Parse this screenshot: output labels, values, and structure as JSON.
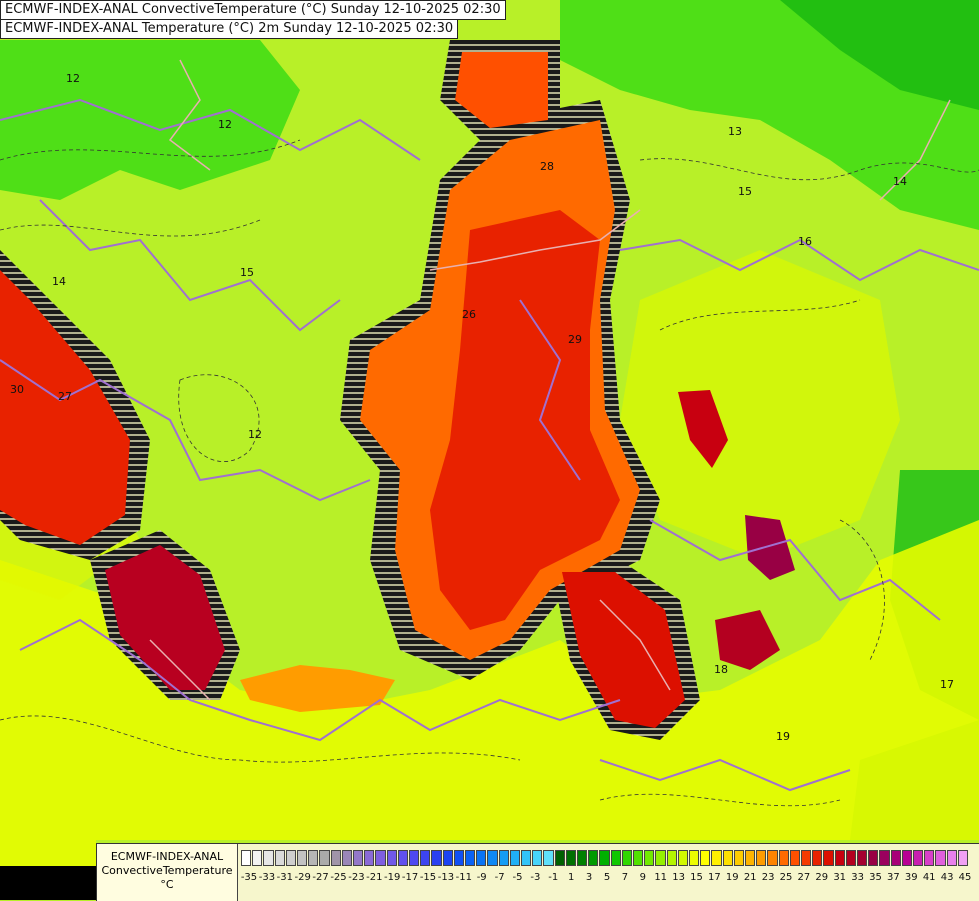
{
  "titles": {
    "line1": "ECMWF-INDEX-ANAL ConvectiveTemperature (°C) Sunday 12-10-2025 02:30",
    "line2": "ECMWF-INDEX-ANAL Temperature (°C) 2m Sunday 12-10-2025 02:30"
  },
  "legend": {
    "model": "ECMWF-INDEX-ANAL",
    "parameter": "ConvectiveTemperature",
    "unit": "°C",
    "tick_labels": [
      "-35",
      "-33",
      "-31",
      "-29",
      "-27",
      "-25",
      "-23",
      "-21",
      "-19",
      "-17",
      "-15",
      "-13",
      "-11",
      "-9",
      "-7",
      "-5",
      "-3",
      "-1",
      "1",
      "3",
      "5",
      "7",
      "9",
      "11",
      "13",
      "15",
      "17",
      "19",
      "21",
      "23",
      "25",
      "27",
      "29",
      "31",
      "33",
      "35",
      "37",
      "39",
      "41",
      "43",
      "45"
    ],
    "colors": [
      "#ffffff",
      "#f2f2f2",
      "#e6e6e6",
      "#dadada",
      "#cecece",
      "#c2c2c2",
      "#b6b6b6",
      "#aaaaaa",
      "#a094a8",
      "#9a86b8",
      "#9478c8",
      "#8a6ad6",
      "#7e5ee0",
      "#7058e8",
      "#6050ee",
      "#4e48f0",
      "#3c44f0",
      "#2a40f0",
      "#1c44f2",
      "#1050f4",
      "#0a62f4",
      "#0a74f4",
      "#0e88f4",
      "#149cf4",
      "#20b0f6",
      "#32c4f8",
      "#48d4fa",
      "#60e0fa",
      "#006000",
      "#007000",
      "#008000",
      "#009a00",
      "#00b000",
      "#10c800",
      "#30d800",
      "#52e200",
      "#72ea00",
      "#94f000",
      "#b4f400",
      "#d2f800",
      "#ecfc00",
      "#ffff00",
      "#fff000",
      "#ffe000",
      "#ffcc00",
      "#ffb400",
      "#ff9c00",
      "#ff8400",
      "#ff6a00",
      "#ff5000",
      "#f43a00",
      "#e82200",
      "#dc1000",
      "#c80010",
      "#b40020",
      "#a40030",
      "#980044",
      "#9a005e",
      "#a80078",
      "#b80094",
      "#c820b0",
      "#d840c8",
      "#e060dc",
      "#e880ec",
      "#f0a0f4"
    ]
  },
  "map": {
    "contour_labels": [
      "12",
      "13",
      "14",
      "15",
      "16",
      "18",
      "17",
      "19",
      "12",
      "14",
      "15",
      "26",
      "28",
      "29",
      "30",
      "27",
      "12"
    ],
    "colors": {
      "background": "#b8f028",
      "green": "#3cdc14",
      "dark_green": "#10b010",
      "yellow": "#e6fc00",
      "orange": "#ff6a00",
      "red": "#e82200",
      "dark_red": "#b80020",
      "boundary": "#a070d0",
      "coast": "#e8b0b0"
    }
  }
}
